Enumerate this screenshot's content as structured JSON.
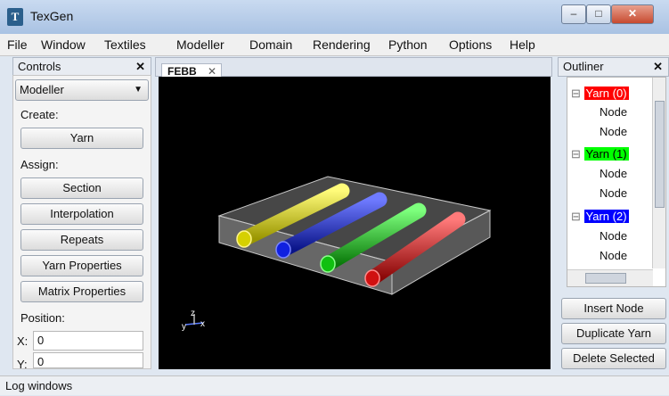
{
  "window": {
    "title": "TexGen",
    "icon": "texgen-app-icon"
  },
  "menu": [
    "File",
    "Window",
    "Textiles",
    "Modeller",
    "Domain",
    "Rendering",
    "Python",
    "Options",
    "Help"
  ],
  "controls": {
    "header": "Controls",
    "close": "✕",
    "mode_select": "Modeller",
    "create_label": "Create:",
    "yarn_button": "Yarn",
    "assign_label": "Assign:",
    "assign_buttons": [
      "Section",
      "Interpolation",
      "Repeats",
      "Yarn Properties",
      "Matrix Properties"
    ],
    "position_label": "Position:",
    "x_label": "X:",
    "x_value": "0",
    "y_label": "Y:",
    "y_value": "0"
  },
  "viewport": {
    "tab_label": "FEBB",
    "tab_close": "✕",
    "yarn_colors": [
      "#e7e200",
      "#1a2cff",
      "#14d21a",
      "#e01616"
    ]
  },
  "outliner": {
    "header": "Outliner",
    "close": "✕",
    "tree": [
      {
        "label": "Yarn (0)",
        "color": "#ff0000",
        "nodes": [
          "Node",
          "Node"
        ]
      },
      {
        "label": "Yarn (1)",
        "color": "#00ff00",
        "nodes": [
          "Node",
          "Node"
        ]
      },
      {
        "label": "Yarn (2)",
        "color": "#0000ff",
        "nodes": [
          "Node",
          "Node"
        ]
      }
    ],
    "buttons": [
      "Insert Node",
      "Duplicate Yarn",
      "Delete Selected"
    ]
  },
  "status": {
    "log": "Log windows"
  }
}
